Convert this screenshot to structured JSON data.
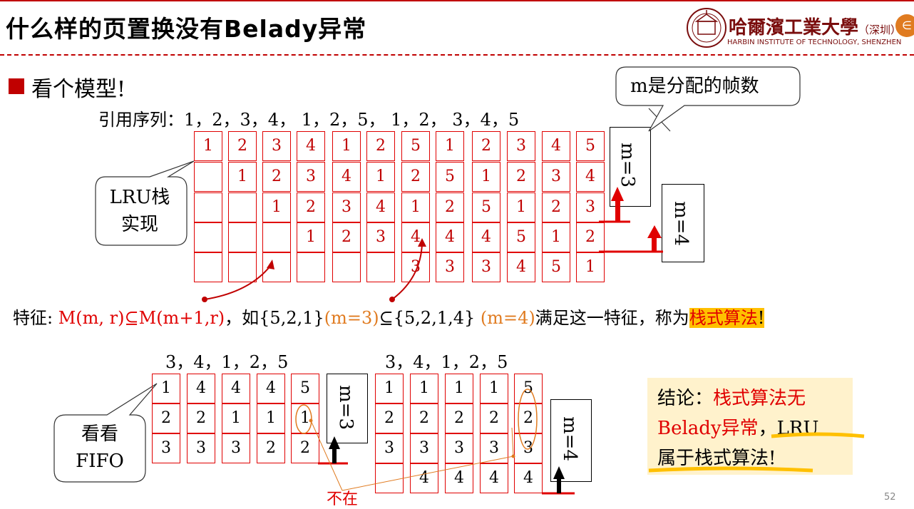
{
  "slide": {
    "title": "什么样的页置换没有Belady异常",
    "page_number": "52"
  },
  "logo": {
    "name_cn": "哈爾濱工業大學",
    "campus_cn": "（深圳）",
    "name_en": "HARBIN INSTITUTE OF TECHNOLOGY, SHENZHEN"
  },
  "bullet": "看个模型!",
  "reference_sequence": "引用序列：1，2，3，4， 1，2，5， 1，2， 3，4，5",
  "lru": {
    "callout": [
      "LRU栈",
      "实现"
    ],
    "columns": [
      [
        "1",
        "",
        "",
        "",
        ""
      ],
      [
        "2",
        "1",
        "",
        "",
        ""
      ],
      [
        "3",
        "2",
        "1",
        "",
        ""
      ],
      [
        "4",
        "3",
        "2",
        "1",
        ""
      ],
      [
        "1",
        "4",
        "3",
        "2",
        ""
      ],
      [
        "2",
        "1",
        "4",
        "3",
        ""
      ],
      [
        "5",
        "2",
        "1",
        "4",
        "3"
      ],
      [
        "1",
        "5",
        "2",
        "4",
        "3"
      ],
      [
        "2",
        "1",
        "5",
        "4",
        "3"
      ],
      [
        "3",
        "2",
        "1",
        "5",
        "4"
      ],
      [
        "4",
        "3",
        "2",
        "1",
        "5"
      ],
      [
        "5",
        "4",
        "3",
        "2",
        "1"
      ]
    ],
    "m3_label": "m=3",
    "m4_label": "m=4",
    "frames_callout": "m是分配的帧数"
  },
  "feature": {
    "prefix": "特征: ",
    "formula": "M(m, r)⊆M(m+1,r)",
    "mid1": "，如{5,2,1}",
    "m3": "(m=3)",
    "mid2": "⊆{5,2,1,4} ",
    "m4": "(m=4)",
    "mid3": "满足这一特征，称为",
    "term": "栈式算法",
    "end": "!"
  },
  "fifo": {
    "callout": [
      "看看",
      "FIFO"
    ],
    "seq_left": "3，4，1，2，5",
    "seq_right": "3，4，1，2，5",
    "m3_columns": [
      [
        "1",
        "2",
        "3"
      ],
      [
        "4",
        "2",
        "3"
      ],
      [
        "4",
        "1",
        "3"
      ],
      [
        "4",
        "1",
        "2"
      ],
      [
        "5",
        "1",
        "2"
      ]
    ],
    "m4_columns": [
      [
        "1",
        "2",
        "3",
        ""
      ],
      [
        "1",
        "2",
        "3",
        "4"
      ],
      [
        "1",
        "2",
        "3",
        "4"
      ],
      [
        "1",
        "2",
        "3",
        "4"
      ],
      [
        "5",
        "2",
        "3",
        "4"
      ]
    ],
    "m3_label": "m=3",
    "m4_label": "m=4",
    "not_in": "不在"
  },
  "conclusion": {
    "line1_a": "结论：",
    "line1_b": "栈式算法无",
    "line2_a": "Belady异常",
    "line2_b": "，LRU",
    "line3": "属于栈式算法!"
  },
  "colors": {
    "accent_red": "#e00000",
    "orange": "#e07b20",
    "highlight": "#ffc000",
    "conclusion_bg": "#fff2cc"
  }
}
